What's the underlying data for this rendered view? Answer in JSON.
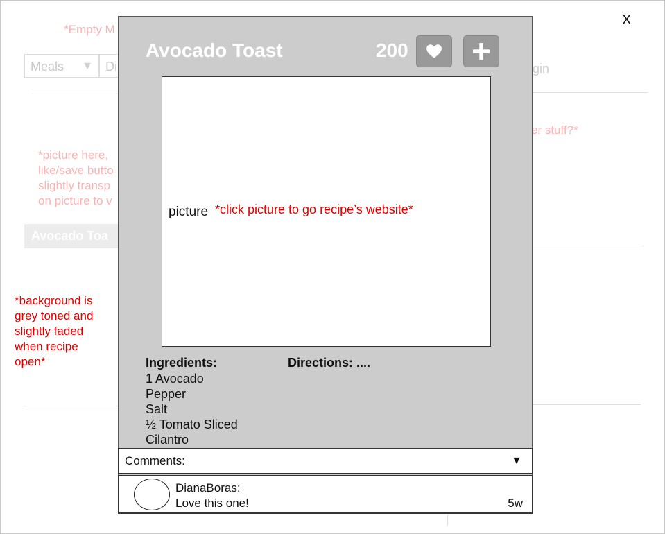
{
  "background": {
    "empty_meals_note": "*Empty M",
    "other_stuff_note": "er stuff?*",
    "picture_note_lines": [
      "*picture here,",
      "like/save butto",
      "slightly transp",
      "on picture to v"
    ],
    "meals_dropdown": "Meals",
    "second_dropdown": "Di",
    "login_partial": "gin",
    "card_title": "Avocado Toa",
    "annotation": "*background is grey toned and slightly faded when recipe open*"
  },
  "close_label": "X",
  "recipe": {
    "title": "Avocado Toast",
    "like_count": "200",
    "picture_label": "picture",
    "picture_note": "*click picture to go recipe’s website*",
    "ingredients_heading": "Ingredients:",
    "ingredients": [
      "1 Avocado",
      "Pepper",
      "Salt",
      "½ Tomato Sliced",
      "Cilantro"
    ],
    "directions_heading": "Directions: ...."
  },
  "comments": {
    "label": "Comments:",
    "dropdown_glyph": "▼",
    "items": [
      {
        "user": "DianaBoras:",
        "text": "Love this one!",
        "time": "5w"
      }
    ]
  },
  "icons": {
    "like": "heart-icon",
    "add": "plus-icon"
  },
  "colors": {
    "modal_bg": "#cccccc",
    "button_bg": "#999999",
    "annotation_red": "#e00000",
    "faded_red": "#f5b5b5"
  }
}
